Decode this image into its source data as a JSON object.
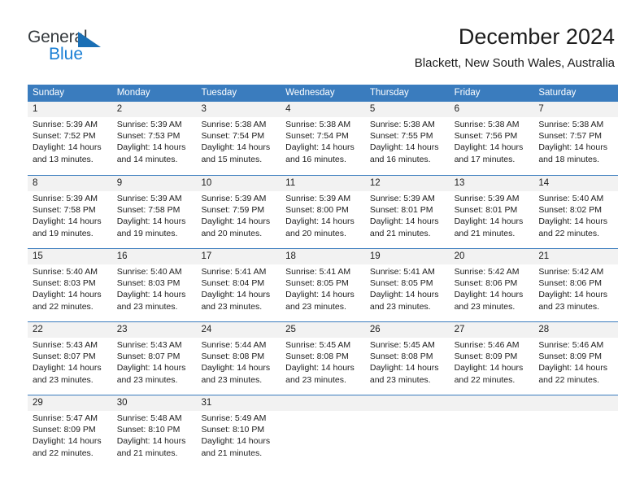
{
  "logo": {
    "word_one": "General",
    "word_two": "Blue",
    "triangle_color": "#1a6fb5",
    "blue_color": "#1a7fd4",
    "dark_color": "#34393d",
    "icon": "general-blue-logo"
  },
  "header": {
    "title": "December 2024",
    "subtitle": "Blackett, New South Wales, Australia"
  },
  "theme": {
    "header_band": "#3a7cbe",
    "row_shade": "#f2f2f2",
    "text": "#1c1c1c"
  },
  "calendar": {
    "day_headers": [
      "Sunday",
      "Monday",
      "Tuesday",
      "Wednesday",
      "Thursday",
      "Friday",
      "Saturday"
    ],
    "weeks": [
      [
        {
          "day": "1",
          "sunrise": "Sunrise: 5:39 AM",
          "sunset": "Sunset: 7:52 PM",
          "daylight_1": "Daylight: 14 hours",
          "daylight_2": "and 13 minutes."
        },
        {
          "day": "2",
          "sunrise": "Sunrise: 5:39 AM",
          "sunset": "Sunset: 7:53 PM",
          "daylight_1": "Daylight: 14 hours",
          "daylight_2": "and 14 minutes."
        },
        {
          "day": "3",
          "sunrise": "Sunrise: 5:38 AM",
          "sunset": "Sunset: 7:54 PM",
          "daylight_1": "Daylight: 14 hours",
          "daylight_2": "and 15 minutes."
        },
        {
          "day": "4",
          "sunrise": "Sunrise: 5:38 AM",
          "sunset": "Sunset: 7:54 PM",
          "daylight_1": "Daylight: 14 hours",
          "daylight_2": "and 16 minutes."
        },
        {
          "day": "5",
          "sunrise": "Sunrise: 5:38 AM",
          "sunset": "Sunset: 7:55 PM",
          "daylight_1": "Daylight: 14 hours",
          "daylight_2": "and 16 minutes."
        },
        {
          "day": "6",
          "sunrise": "Sunrise: 5:38 AM",
          "sunset": "Sunset: 7:56 PM",
          "daylight_1": "Daylight: 14 hours",
          "daylight_2": "and 17 minutes."
        },
        {
          "day": "7",
          "sunrise": "Sunrise: 5:38 AM",
          "sunset": "Sunset: 7:57 PM",
          "daylight_1": "Daylight: 14 hours",
          "daylight_2": "and 18 minutes."
        }
      ],
      [
        {
          "day": "8",
          "sunrise": "Sunrise: 5:39 AM",
          "sunset": "Sunset: 7:58 PM",
          "daylight_1": "Daylight: 14 hours",
          "daylight_2": "and 19 minutes."
        },
        {
          "day": "9",
          "sunrise": "Sunrise: 5:39 AM",
          "sunset": "Sunset: 7:58 PM",
          "daylight_1": "Daylight: 14 hours",
          "daylight_2": "and 19 minutes."
        },
        {
          "day": "10",
          "sunrise": "Sunrise: 5:39 AM",
          "sunset": "Sunset: 7:59 PM",
          "daylight_1": "Daylight: 14 hours",
          "daylight_2": "and 20 minutes."
        },
        {
          "day": "11",
          "sunrise": "Sunrise: 5:39 AM",
          "sunset": "Sunset: 8:00 PM",
          "daylight_1": "Daylight: 14 hours",
          "daylight_2": "and 20 minutes."
        },
        {
          "day": "12",
          "sunrise": "Sunrise: 5:39 AM",
          "sunset": "Sunset: 8:01 PM",
          "daylight_1": "Daylight: 14 hours",
          "daylight_2": "and 21 minutes."
        },
        {
          "day": "13",
          "sunrise": "Sunrise: 5:39 AM",
          "sunset": "Sunset: 8:01 PM",
          "daylight_1": "Daylight: 14 hours",
          "daylight_2": "and 21 minutes."
        },
        {
          "day": "14",
          "sunrise": "Sunrise: 5:40 AM",
          "sunset": "Sunset: 8:02 PM",
          "daylight_1": "Daylight: 14 hours",
          "daylight_2": "and 22 minutes."
        }
      ],
      [
        {
          "day": "15",
          "sunrise": "Sunrise: 5:40 AM",
          "sunset": "Sunset: 8:03 PM",
          "daylight_1": "Daylight: 14 hours",
          "daylight_2": "and 22 minutes."
        },
        {
          "day": "16",
          "sunrise": "Sunrise: 5:40 AM",
          "sunset": "Sunset: 8:03 PM",
          "daylight_1": "Daylight: 14 hours",
          "daylight_2": "and 23 minutes."
        },
        {
          "day": "17",
          "sunrise": "Sunrise: 5:41 AM",
          "sunset": "Sunset: 8:04 PM",
          "daylight_1": "Daylight: 14 hours",
          "daylight_2": "and 23 minutes."
        },
        {
          "day": "18",
          "sunrise": "Sunrise: 5:41 AM",
          "sunset": "Sunset: 8:05 PM",
          "daylight_1": "Daylight: 14 hours",
          "daylight_2": "and 23 minutes."
        },
        {
          "day": "19",
          "sunrise": "Sunrise: 5:41 AM",
          "sunset": "Sunset: 8:05 PM",
          "daylight_1": "Daylight: 14 hours",
          "daylight_2": "and 23 minutes."
        },
        {
          "day": "20",
          "sunrise": "Sunrise: 5:42 AM",
          "sunset": "Sunset: 8:06 PM",
          "daylight_1": "Daylight: 14 hours",
          "daylight_2": "and 23 minutes."
        },
        {
          "day": "21",
          "sunrise": "Sunrise: 5:42 AM",
          "sunset": "Sunset: 8:06 PM",
          "daylight_1": "Daylight: 14 hours",
          "daylight_2": "and 23 minutes."
        }
      ],
      [
        {
          "day": "22",
          "sunrise": "Sunrise: 5:43 AM",
          "sunset": "Sunset: 8:07 PM",
          "daylight_1": "Daylight: 14 hours",
          "daylight_2": "and 23 minutes."
        },
        {
          "day": "23",
          "sunrise": "Sunrise: 5:43 AM",
          "sunset": "Sunset: 8:07 PM",
          "daylight_1": "Daylight: 14 hours",
          "daylight_2": "and 23 minutes."
        },
        {
          "day": "24",
          "sunrise": "Sunrise: 5:44 AM",
          "sunset": "Sunset: 8:08 PM",
          "daylight_1": "Daylight: 14 hours",
          "daylight_2": "and 23 minutes."
        },
        {
          "day": "25",
          "sunrise": "Sunrise: 5:45 AM",
          "sunset": "Sunset: 8:08 PM",
          "daylight_1": "Daylight: 14 hours",
          "daylight_2": "and 23 minutes."
        },
        {
          "day": "26",
          "sunrise": "Sunrise: 5:45 AM",
          "sunset": "Sunset: 8:08 PM",
          "daylight_1": "Daylight: 14 hours",
          "daylight_2": "and 23 minutes."
        },
        {
          "day": "27",
          "sunrise": "Sunrise: 5:46 AM",
          "sunset": "Sunset: 8:09 PM",
          "daylight_1": "Daylight: 14 hours",
          "daylight_2": "and 22 minutes."
        },
        {
          "day": "28",
          "sunrise": "Sunrise: 5:46 AM",
          "sunset": "Sunset: 8:09 PM",
          "daylight_1": "Daylight: 14 hours",
          "daylight_2": "and 22 minutes."
        }
      ],
      [
        {
          "day": "29",
          "sunrise": "Sunrise: 5:47 AM",
          "sunset": "Sunset: 8:09 PM",
          "daylight_1": "Daylight: 14 hours",
          "daylight_2": "and 22 minutes."
        },
        {
          "day": "30",
          "sunrise": "Sunrise: 5:48 AM",
          "sunset": "Sunset: 8:10 PM",
          "daylight_1": "Daylight: 14 hours",
          "daylight_2": "and 21 minutes."
        },
        {
          "day": "31",
          "sunrise": "Sunrise: 5:49 AM",
          "sunset": "Sunset: 8:10 PM",
          "daylight_1": "Daylight: 14 hours",
          "daylight_2": "and 21 minutes."
        },
        {
          "day": "",
          "sunrise": "",
          "sunset": "",
          "daylight_1": "",
          "daylight_2": ""
        },
        {
          "day": "",
          "sunrise": "",
          "sunset": "",
          "daylight_1": "",
          "daylight_2": ""
        },
        {
          "day": "",
          "sunrise": "",
          "sunset": "",
          "daylight_1": "",
          "daylight_2": ""
        },
        {
          "day": "",
          "sunrise": "",
          "sunset": "",
          "daylight_1": "",
          "daylight_2": ""
        }
      ]
    ]
  }
}
